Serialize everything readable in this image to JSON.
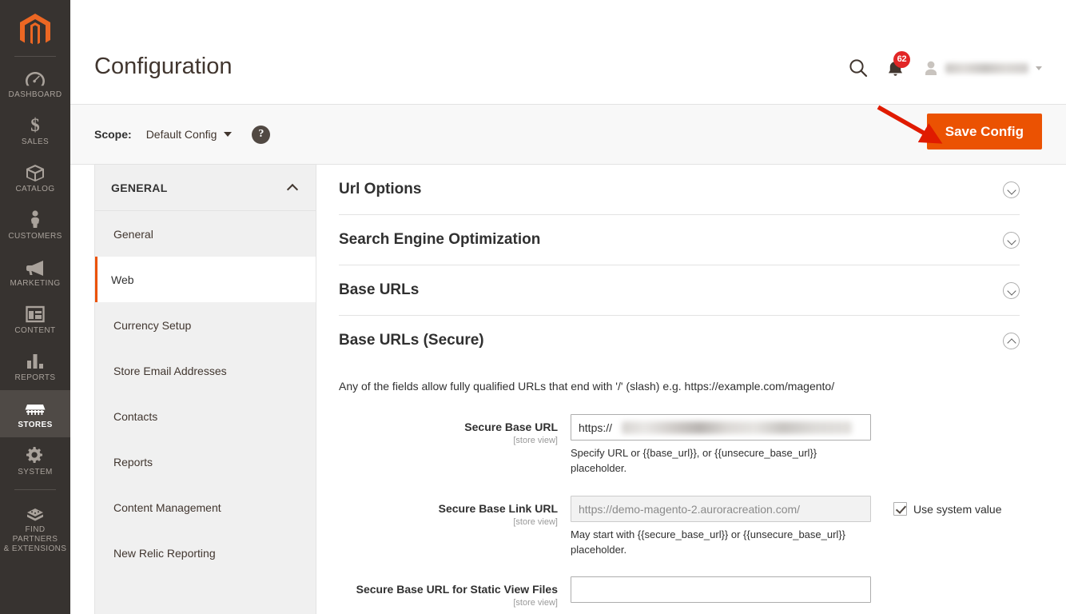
{
  "sidebar": {
    "logo": "magento-logo",
    "items": [
      {
        "label": "Dashboard",
        "icon": "dashboard-icon",
        "active": false
      },
      {
        "label": "Sales",
        "icon": "sales-icon",
        "active": false
      },
      {
        "label": "Catalog",
        "icon": "catalog-icon",
        "active": false
      },
      {
        "label": "Customers",
        "icon": "customers-icon",
        "active": false
      },
      {
        "label": "Marketing",
        "icon": "marketing-icon",
        "active": false
      },
      {
        "label": "Content",
        "icon": "content-icon",
        "active": false
      },
      {
        "label": "Reports",
        "icon": "reports-icon",
        "active": false
      },
      {
        "label": "Stores",
        "icon": "stores-icon",
        "active": true
      },
      {
        "label": "System",
        "icon": "system-icon",
        "active": false
      },
      {
        "label": "Find Partners\n& Extensions",
        "icon": "extensions-icon",
        "active": false
      }
    ],
    "extensions_line1": "Find Partners",
    "extensions_line2": "& Extensions"
  },
  "header": {
    "title": "Configuration",
    "search_icon": "search-icon",
    "notifications_icon": "bell-icon",
    "notifications_count": "62",
    "user_name": "",
    "avatar_icon": "avatar-icon"
  },
  "scope_bar": {
    "label": "Scope:",
    "selected": "Default Config",
    "help_label": "?",
    "save_label": "Save Config"
  },
  "config_nav": {
    "group_title": "GENERAL",
    "items": [
      {
        "label": "General",
        "active": false
      },
      {
        "label": "Web",
        "active": true
      },
      {
        "label": "Currency Setup",
        "active": false
      },
      {
        "label": "Store Email Addresses",
        "active": false
      },
      {
        "label": "Contacts",
        "active": false
      },
      {
        "label": "Reports",
        "active": false
      },
      {
        "label": "Content Management",
        "active": false
      },
      {
        "label": "New Relic Reporting",
        "active": false
      }
    ]
  },
  "sections": [
    {
      "title": "Url Options",
      "expanded": false
    },
    {
      "title": "Search Engine Optimization",
      "expanded": false
    },
    {
      "title": "Base URLs",
      "expanded": false
    },
    {
      "title": "Base URLs (Secure)",
      "expanded": true
    }
  ],
  "base_urls_secure": {
    "note": "Any of the fields allow fully qualified URLs that end with '/' (slash) e.g. https://example.com/magento/",
    "fields": [
      {
        "label": "Secure Base URL",
        "scope": "[store view]",
        "value": "https://",
        "redacted": true,
        "disabled": false,
        "hint": "Specify URL or {{base_url}}, or {{unsecure_base_url}} placeholder.",
        "has_system_value": false,
        "system_value_label": "",
        "system_value_checked": false
      },
      {
        "label": "Secure Base Link URL",
        "scope": "[store view]",
        "value": "https://demo-magento-2.auroracreation.com/",
        "redacted": false,
        "disabled": true,
        "hint": "May start with {{secure_base_url}} or {{unsecure_base_url}} placeholder.",
        "has_system_value": true,
        "system_value_label": "Use system value",
        "system_value_checked": true
      },
      {
        "label": "Secure Base URL for Static View Files",
        "scope": "[store view]",
        "value": "",
        "redacted": false,
        "disabled": false,
        "hint": "",
        "has_system_value": false,
        "system_value_label": "",
        "system_value_checked": false
      }
    ]
  },
  "annotation": {
    "type": "red-arrow",
    "color": "#e01b00",
    "points_to": "save-config-button"
  },
  "colors": {
    "brand_orange": "#eb5202",
    "sidebar_bg": "#373330",
    "badge_red": "#e22626",
    "annotation_red": "#e01b00"
  }
}
